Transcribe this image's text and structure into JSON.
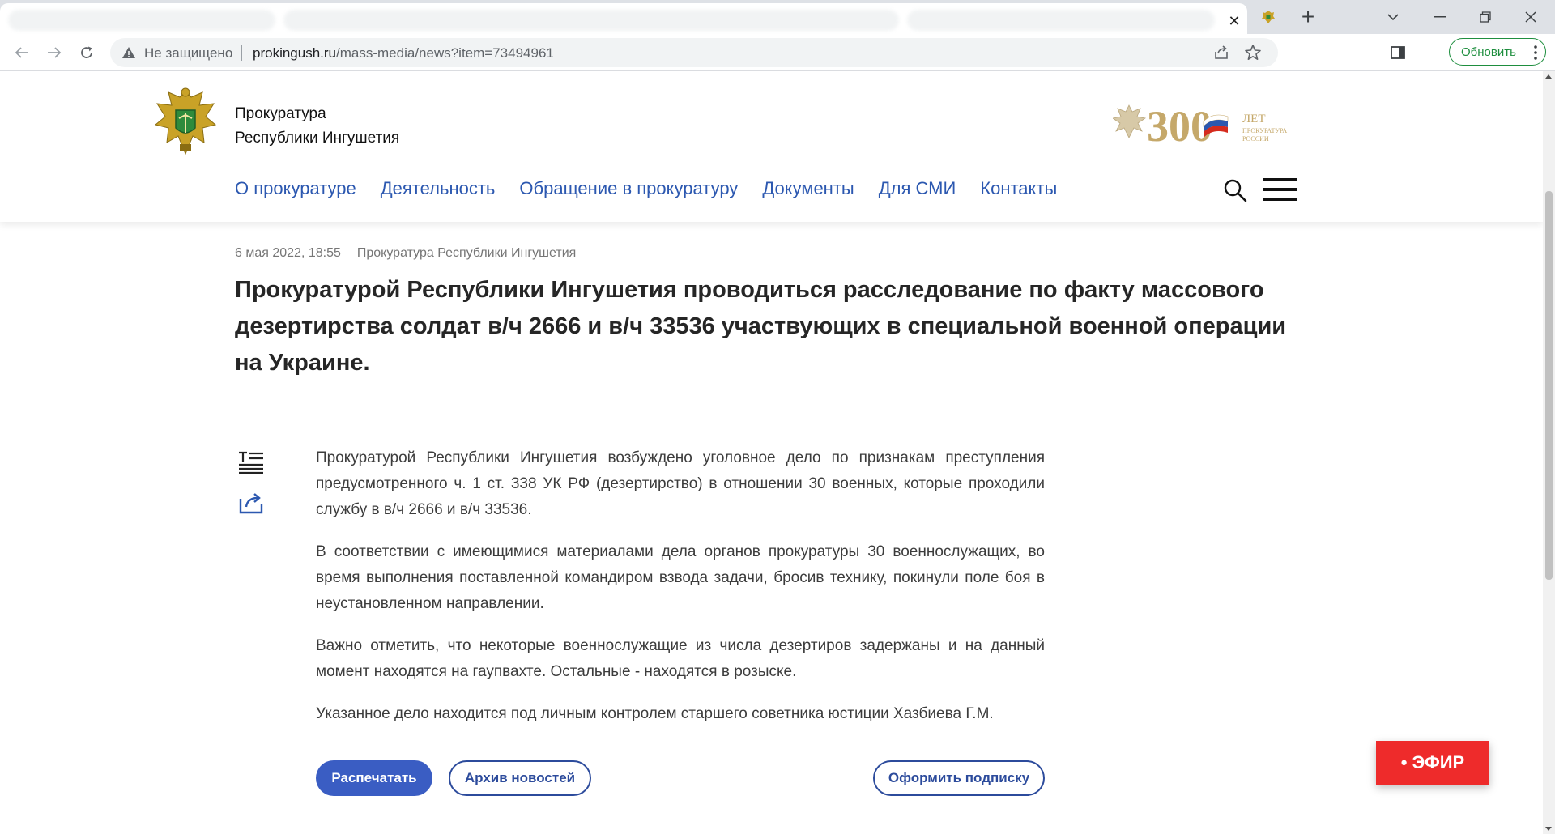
{
  "browser": {
    "tab_close_glyph": "✕",
    "new_tab_glyph": "+",
    "insecure_label": "Не защищено",
    "url_host": "prokingush.ru",
    "url_path": "/mass-media/news?item=73494961",
    "update_label": "Обновить"
  },
  "site": {
    "org_line1": "Прокуратура",
    "org_line2": "Республики Ингушетия",
    "anniversary": {
      "number": "300",
      "word": "ЛЕТ",
      "line1": "ПРОКУРАТУРА",
      "line2": "РОССИИ"
    },
    "nav": [
      {
        "label": "О прокуратуре"
      },
      {
        "label": "Деятельность"
      },
      {
        "label": "Обращение в прокуратуру"
      },
      {
        "label": "Документы"
      },
      {
        "label": "Для СМИ"
      },
      {
        "label": "Контакты"
      }
    ]
  },
  "article": {
    "date": "6 мая 2022, 18:55",
    "source": "Прокуратура Республики Ингушетия",
    "title": "Прокуратурой Республики Ингушетия проводиться расследование по факту массового дезертирства солдат в/ч 2666 и в/ч 33536 участвующих в специальной военной операции на Украине.",
    "paragraphs": [
      "Прокуратурой Республики Ингушетия возбуждено уголовное дело по признакам преступления предусмотренного ч. 1 ст. 338 УК РФ (дезертирство) в отношении 30 военных, которые проходили службу в в/ч 2666 и в/ч 33536.",
      "В соответствии с имеющимися материалами дела органов прокуратуры 30 военнослужащих, во время выполнения поставленной командиром взвода задачи, бросив технику, покинули поле боя в неустановленном направлении.",
      "Важно отметить, что некоторые военнослужащие из числа дезертиров задержаны и на данный момент находятся на гаупвахте. Остальные - находятся в розыске.",
      "Указанное дело находится под личным контролем старшего советника юстиции Хазбиева Г.М."
    ],
    "print_label": "Распечатать",
    "archive_label": "Архив новостей",
    "subscribe_label": "Оформить подписку"
  },
  "live": {
    "label": "• ЭФИР"
  },
  "colors": {
    "nav_link": "#2c58b0",
    "primary_button": "#3a5dc3",
    "live_badge": "#ee2b2b",
    "update_green": "#1e8e3e"
  }
}
